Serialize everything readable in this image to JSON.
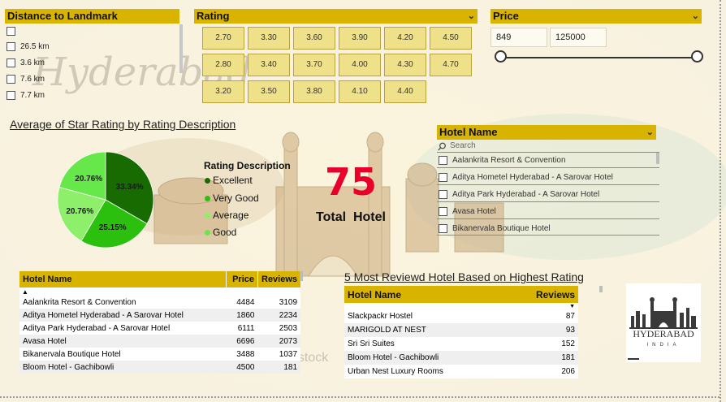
{
  "distance_slicer": {
    "title": "Distance to Landmark",
    "items": [
      "",
      "26.5 km",
      "3.6 km",
      "7.6 km",
      "7.7 km"
    ]
  },
  "rating_slicer": {
    "title": "Rating",
    "tiles": [
      "2.70",
      "3.30",
      "3.60",
      "3.90",
      "4.20",
      "4.50",
      "2.80",
      "3.40",
      "3.70",
      "4.00",
      "4.30",
      "4.70",
      "3.20",
      "3.50",
      "3.80",
      "4.10",
      "4.40"
    ]
  },
  "price_slicer": {
    "title": "Price",
    "min_value": "849",
    "max_value": "125000",
    "range_selected": [
      0,
      1
    ]
  },
  "pie_chart": {
    "title": "Average of Star Rating by Rating Description",
    "legend_title": "Rating Description",
    "colors": {
      "Excellent": "#176b00",
      "Very Good": "#2cc00e",
      "Average": "#8ef06a",
      "Good": "#66e84a"
    }
  },
  "chart_data": {
    "type": "pie",
    "title": "Average of Star Rating by Rating Description",
    "categories": [
      "Excellent",
      "Very Good",
      "Average",
      "Good"
    ],
    "values": [
      33.34,
      25.15,
      20.76,
      20.76
    ],
    "labels": [
      "33.34%",
      "25.15%",
      "20.76%",
      "20.76%"
    ],
    "legend_position": "right"
  },
  "kpi": {
    "value": "75",
    "label": "Total  Hotel",
    "color": "#e8002a"
  },
  "hotel_slicer": {
    "title": "Hotel Name",
    "search_placeholder": "Search",
    "items": [
      "Aalankrita Resort & Convention",
      "Aditya Hometel Hyderabad - A Sarovar Hotel",
      "Aditya Park Hyderabad - A Sarovar Hotel",
      "Avasa Hotel",
      "Bikanervala Boutique Hotel"
    ]
  },
  "hotel_table": {
    "columns": [
      "Hotel Name",
      "Price",
      "Reviews"
    ],
    "rows": [
      [
        "Aalankrita Resort & Convention",
        "4484",
        "3109"
      ],
      [
        "Aditya Hometel Hyderabad - A Sarovar Hotel",
        "1860",
        "2234"
      ],
      [
        "Aditya Park Hyderabad - A Sarovar Hotel",
        "6111",
        "2503"
      ],
      [
        "Avasa Hotel",
        "6696",
        "2073"
      ],
      [
        "Bikanervala Boutique Hotel",
        "3488",
        "1037"
      ],
      [
        "Bloom Hotel - Gachibowli",
        "4500",
        "181"
      ]
    ]
  },
  "top_reviewed": {
    "title": "5 Most Reviewd Hotel Based on Highest Rating",
    "columns": [
      "Hotel Name",
      "Reviews"
    ],
    "rows": [
      [
        "Slackpackr Hostel",
        "87"
      ],
      [
        "MARIGOLD AT NEST",
        "93"
      ],
      [
        "Sri Sri Suites",
        "152"
      ],
      [
        "Bloom Hotel - Gachibowli",
        "181"
      ],
      [
        "Urban Nest Luxury Rooms",
        "206"
      ]
    ]
  },
  "logo": {
    "text": "HYDERABAD",
    "subtext": "INDIA"
  },
  "background": {
    "watermark_text": "Hyderabad",
    "stock_text": "shutterstock"
  }
}
